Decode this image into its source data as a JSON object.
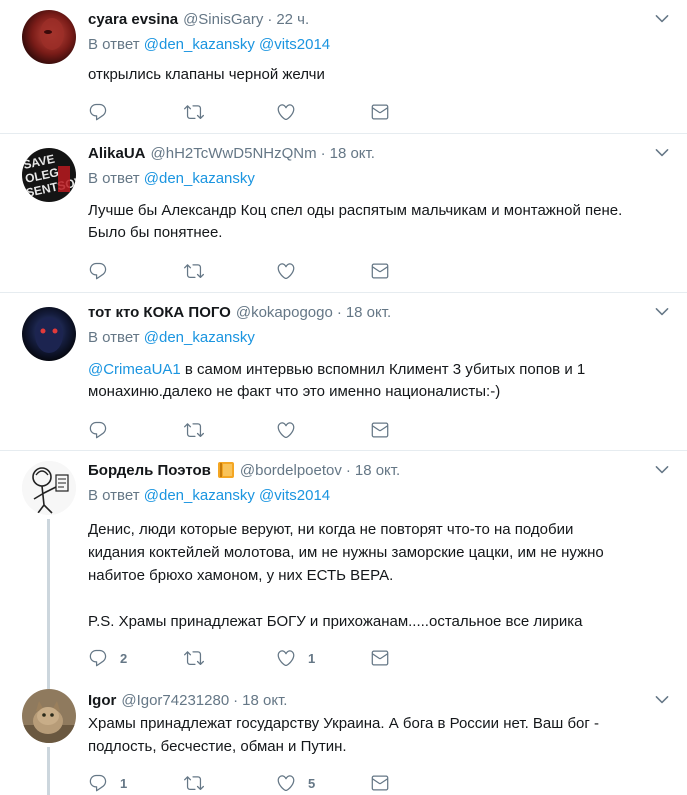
{
  "tweets": [
    {
      "name": "cyara evsina",
      "handle": "@SinisGary",
      "dot": "·",
      "time": "22 ч.",
      "reply_prefix": "В ответ",
      "mentions": [
        "@den_kazansky",
        "@vits2014"
      ],
      "text": "открылись клапаны черной желчи",
      "replies": "",
      "retweets": "",
      "likes": ""
    },
    {
      "name": "AlikaUA",
      "handle": "@hH2TcWwD5NHzQNm",
      "dot": "·",
      "time": "18 окт.",
      "reply_prefix": "В ответ",
      "mentions": [
        "@den_kazansky"
      ],
      "avatar_text": "SAVE OLEG SENTSOV",
      "text_lines": [
        "Лучше бы Александр Коц спел оды распятым мальчикам и монтажной пене.",
        "Было бы понятнее."
      ],
      "replies": "",
      "retweets": "",
      "likes": ""
    },
    {
      "name": "тот кто КОКА ПОГО",
      "handle": "@kokapogogo",
      "dot": "·",
      "time": "18 окт.",
      "reply_prefix": "В ответ",
      "mentions": [
        "@den_kazansky"
      ],
      "text_mention": "@CrimeaUA1",
      "text_lines": [
        " в самом интервью вспомнил Климент 3 убитых попов и 1",
        "монахиню.далеко не факт что это именно националисты:-)"
      ],
      "replies": "",
      "retweets": "",
      "likes": ""
    },
    {
      "name": "Бордель Поэтов",
      "handle": "@bordelpoetov",
      "dot": "·",
      "time": "18 окт.",
      "badge_icon": "book-icon",
      "reply_prefix": "В ответ",
      "mentions": [
        "@den_kazansky",
        "@vits2014"
      ],
      "text_lines": [
        "Денис, люди которые веруют, ни когда не повторят что-то на подобии",
        "кидания коктейлей молотова, им не нужны заморские цацки, им не нужно",
        "набитое брюхо хамоном, у них ЕСТЬ ВЕРА.",
        "",
        "P.S. Храмы принадлежат БОГУ и прихожанам.....остальное все лирика"
      ],
      "replies": "2",
      "retweets": "",
      "likes": "1"
    },
    {
      "name": "Igor",
      "handle": "@Igor74231280",
      "dot": "·",
      "time": "18 окт.",
      "text_lines": [
        "Храмы принадлежат государству Украина. А бога в России нет. Ваш бог -",
        "подлость, бесчестие, обман и Путин."
      ],
      "replies": "1",
      "retweets": "",
      "likes": "5"
    }
  ],
  "colors": {
    "text": "#14171a",
    "secondary": "#657786",
    "link": "#1b95e0",
    "divider": "#e6ecf0",
    "thread": "#ccd6dd"
  }
}
